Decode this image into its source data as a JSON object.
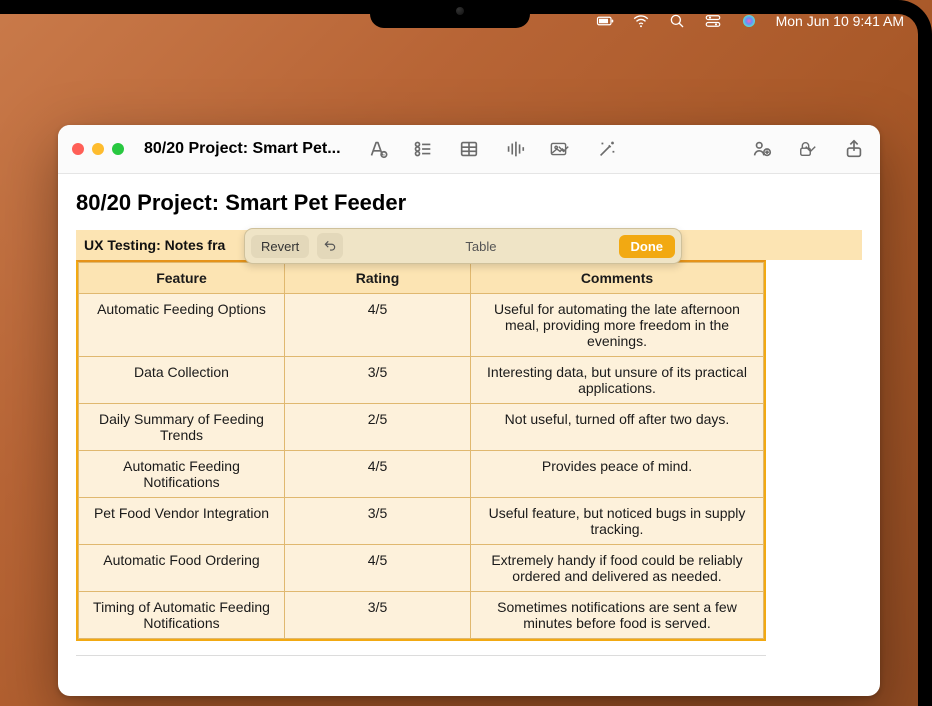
{
  "menubar": {
    "datetime": "Mon Jun 10  9:41 AM"
  },
  "window": {
    "title": "80/20 Project: Smart Pet..."
  },
  "document": {
    "title": "80/20 Project: Smart Pet Feeder",
    "subtitle": "UX Testing: Notes fra"
  },
  "format_bar": {
    "revert": "Revert",
    "label": "Table",
    "done": "Done"
  },
  "table": {
    "headers": [
      "Feature",
      "Rating",
      "Comments"
    ],
    "rows": [
      {
        "feature": "Automatic Feeding Options",
        "rating": "4/5",
        "comments": "Useful for automating the late afternoon meal, providing more freedom in the evenings."
      },
      {
        "feature": "Data Collection",
        "rating": "3/5",
        "comments": "Interesting data, but unsure of its practical applications."
      },
      {
        "feature": "Daily Summary of Feeding Trends",
        "rating": "2/5",
        "comments": "Not useful, turned off after two days."
      },
      {
        "feature": "Automatic Feeding Notifications",
        "rating": "4/5",
        "comments": "Provides peace of mind."
      },
      {
        "feature": "Pet Food Vendor Integration",
        "rating": "3/5",
        "comments": "Useful feature, but noticed bugs in supply tracking."
      },
      {
        "feature": "Automatic Food Ordering",
        "rating": "4/5",
        "comments": "Extremely handy if food could be reliably ordered and delivered as needed."
      },
      {
        "feature": "Timing of Automatic Feeding Notifications",
        "rating": "3/5",
        "comments": "Sometimes notifications are sent a few minutes before food is served."
      }
    ]
  }
}
